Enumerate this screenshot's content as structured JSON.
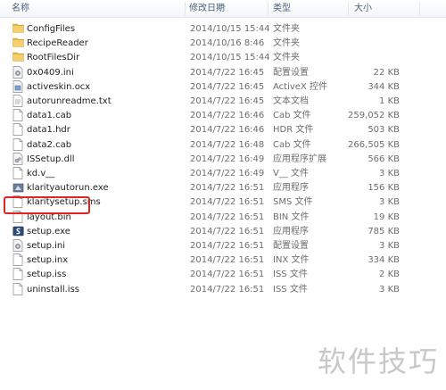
{
  "columns": {
    "name": "名称",
    "date": "修改日期",
    "type": "类型",
    "size": "大小"
  },
  "files": [
    {
      "name": "ConfigFiles",
      "date": "2014/10/15 15:44",
      "type": "文件夹",
      "size": "",
      "icon": "folder-icon"
    },
    {
      "name": "RecipeReader",
      "date": "2014/10/16 8:46",
      "type": "文件夹",
      "size": "",
      "icon": "folder-icon"
    },
    {
      "name": "RootFilesDir",
      "date": "2014/10/15 15:44",
      "type": "文件夹",
      "size": "",
      "icon": "folder-icon"
    },
    {
      "name": "0x0409.ini",
      "date": "2014/7/22 16:45",
      "type": "配置设置",
      "size": "22 KB",
      "icon": "settings-file-icon"
    },
    {
      "name": "activeskin.ocx",
      "date": "2014/7/22 16:45",
      "type": "ActiveX 控件",
      "size": "344 KB",
      "icon": "activex-file-icon"
    },
    {
      "name": "autorunreadme.txt",
      "date": "2014/7/22 16:45",
      "type": "文本文档",
      "size": "1 KB",
      "icon": "text-file-icon"
    },
    {
      "name": "data1.cab",
      "date": "2014/7/22 16:46",
      "type": "Cab 文件",
      "size": "259,052 KB",
      "icon": "generic-file-icon"
    },
    {
      "name": "data1.hdr",
      "date": "2014/7/22 16:46",
      "type": "HDR 文件",
      "size": "503 KB",
      "icon": "generic-file-icon"
    },
    {
      "name": "data2.cab",
      "date": "2014/7/22 16:48",
      "type": "Cab 文件",
      "size": "266,505 KB",
      "icon": "generic-file-icon"
    },
    {
      "name": "ISSetup.dll",
      "date": "2014/7/22 16:49",
      "type": "应用程序扩展",
      "size": "566 KB",
      "icon": "dll-file-icon"
    },
    {
      "name": "kd.v__",
      "date": "2014/7/22 16:49",
      "type": "V__ 文件",
      "size": "3 KB",
      "icon": "generic-file-icon"
    },
    {
      "name": "klarityautorun.exe",
      "date": "2014/7/22 16:51",
      "type": "应用程序",
      "size": "156 KB",
      "icon": "app-exe-icon"
    },
    {
      "name": "klaritysetup.sms",
      "date": "2014/7/22 16:51",
      "type": "SMS 文件",
      "size": "3 KB",
      "icon": "generic-file-icon"
    },
    {
      "name": "layout.bin",
      "date": "2014/7/22 16:51",
      "type": "BIN 文件",
      "size": "19 KB",
      "icon": "generic-file-icon"
    },
    {
      "name": "setup.exe",
      "date": "2014/7/22 16:51",
      "type": "应用程序",
      "size": "785 KB",
      "icon": "setup-exe-icon"
    },
    {
      "name": "setup.ini",
      "date": "2014/7/22 16:51",
      "type": "配置设置",
      "size": "3 KB",
      "icon": "settings-file-icon"
    },
    {
      "name": "setup.inx",
      "date": "2014/7/22 16:51",
      "type": "INX 文件",
      "size": "334 KB",
      "icon": "generic-file-icon"
    },
    {
      "name": "setup.iss",
      "date": "2014/7/22 16:51",
      "type": "ISS 文件",
      "size": "2 KB",
      "icon": "generic-file-icon"
    },
    {
      "name": "uninstall.iss",
      "date": "2014/7/22 16:51",
      "type": "ISS 文件",
      "size": "3 KB",
      "icon": "generic-file-icon"
    }
  ],
  "watermark": "软件技巧",
  "colors": {
    "folder": "#e8b84a",
    "highlight_border": "#e02424",
    "header_text": "#4c607a"
  }
}
